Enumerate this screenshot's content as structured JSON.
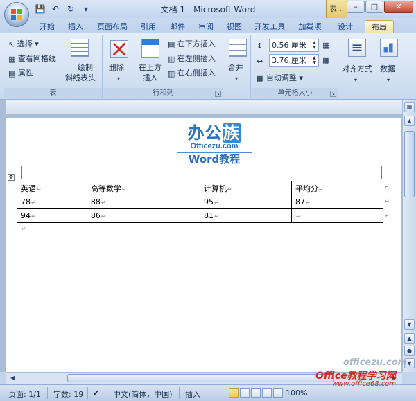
{
  "window": {
    "title": "文档 1 - Microsoft Word",
    "context_tab_title": "表..."
  },
  "quick_access": {
    "icons": [
      "save-icon",
      "undo-icon",
      "redo-icon",
      "customize-icon"
    ]
  },
  "tabs": [
    {
      "label": "开始",
      "active": false
    },
    {
      "label": "插入",
      "active": false
    },
    {
      "label": "页面布局",
      "active": false
    },
    {
      "label": "引用",
      "active": false
    },
    {
      "label": "邮件",
      "active": false
    },
    {
      "label": "审阅",
      "active": false
    },
    {
      "label": "视图",
      "active": false
    },
    {
      "label": "开发工具",
      "active": false
    },
    {
      "label": "加载项",
      "active": false
    },
    {
      "label": "设计",
      "active": false
    },
    {
      "label": "布局",
      "active": true
    }
  ],
  "ribbon": {
    "table_group": {
      "label": "表",
      "select": "选择",
      "view_gridlines": "查看网格线",
      "properties": "属性",
      "draw_diagonal_line1": "绘制",
      "draw_diagonal_line2": "斜线表头"
    },
    "rows_cols_group": {
      "label": "行和列",
      "delete": "删除",
      "insert_above1": "在上方",
      "insert_above2": "插入",
      "insert_below": "在下方插入",
      "insert_left": "在左侧插入",
      "insert_right": "在右侧插入"
    },
    "merge_group": {
      "merge": "合并"
    },
    "cell_size_group": {
      "label": "单元格大小",
      "height_value": "0.56 厘米",
      "width_value": "3.76 厘米",
      "autofit": "自动调整"
    },
    "alignment_group": {
      "label": "对齐方式"
    },
    "data_group": {
      "label": "数据"
    }
  },
  "logo": {
    "main_prefix": "办公",
    "main_highlight": "族",
    "sub": "Officezu.com",
    "word": "Word教程"
  },
  "table": {
    "rows": [
      [
        "英语",
        "高等数学",
        "计算机",
        "平均分"
      ],
      [
        "78",
        "88",
        "95",
        "87"
      ],
      [
        "94",
        "86",
        "81",
        ""
      ]
    ]
  },
  "watermark": {
    "top": "officezu.com",
    "main": "Office教程学习网",
    "url": "www.office68.com"
  },
  "status_bar": {
    "page": "页面: 1/1",
    "word_count": "字数: 19",
    "language": "中文(简体，中国)",
    "mode": "插入",
    "zoom": "100%"
  }
}
